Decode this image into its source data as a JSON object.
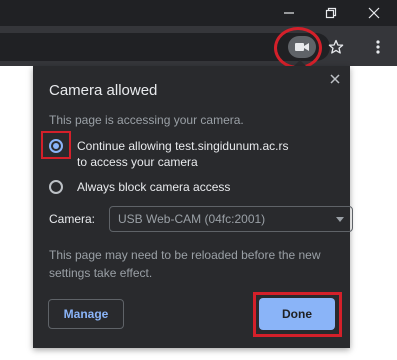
{
  "window": {
    "minimize_icon": "minimize-icon",
    "restore_icon": "restore-icon",
    "close_icon": "close-icon"
  },
  "toolbar": {
    "camera_indicator_icon": "video-camera-icon",
    "bookmark_icon": "star-icon",
    "menu_icon": "kebab-menu-icon"
  },
  "bubble": {
    "title": "Camera allowed",
    "subtitle": "This page is accessing your camera.",
    "options": [
      {
        "label_line1": "Continue allowing test.singidunum.ac.rs",
        "label_line2": "to access your camera",
        "selected": true
      },
      {
        "label_line1": "Always block camera access",
        "label_line2": "",
        "selected": false
      }
    ],
    "camera_label": "Camera:",
    "camera_selected": "USB Web-CAM (04fc:2001)",
    "note": "This page may need to be reloaded before the new settings take effect.",
    "manage_label": "Manage",
    "done_label": "Done"
  },
  "colors": {
    "accent": "#8ab4f8",
    "annotation": "#d4202a",
    "bubble_bg": "#292a2d",
    "chrome_dark": "#202124"
  }
}
